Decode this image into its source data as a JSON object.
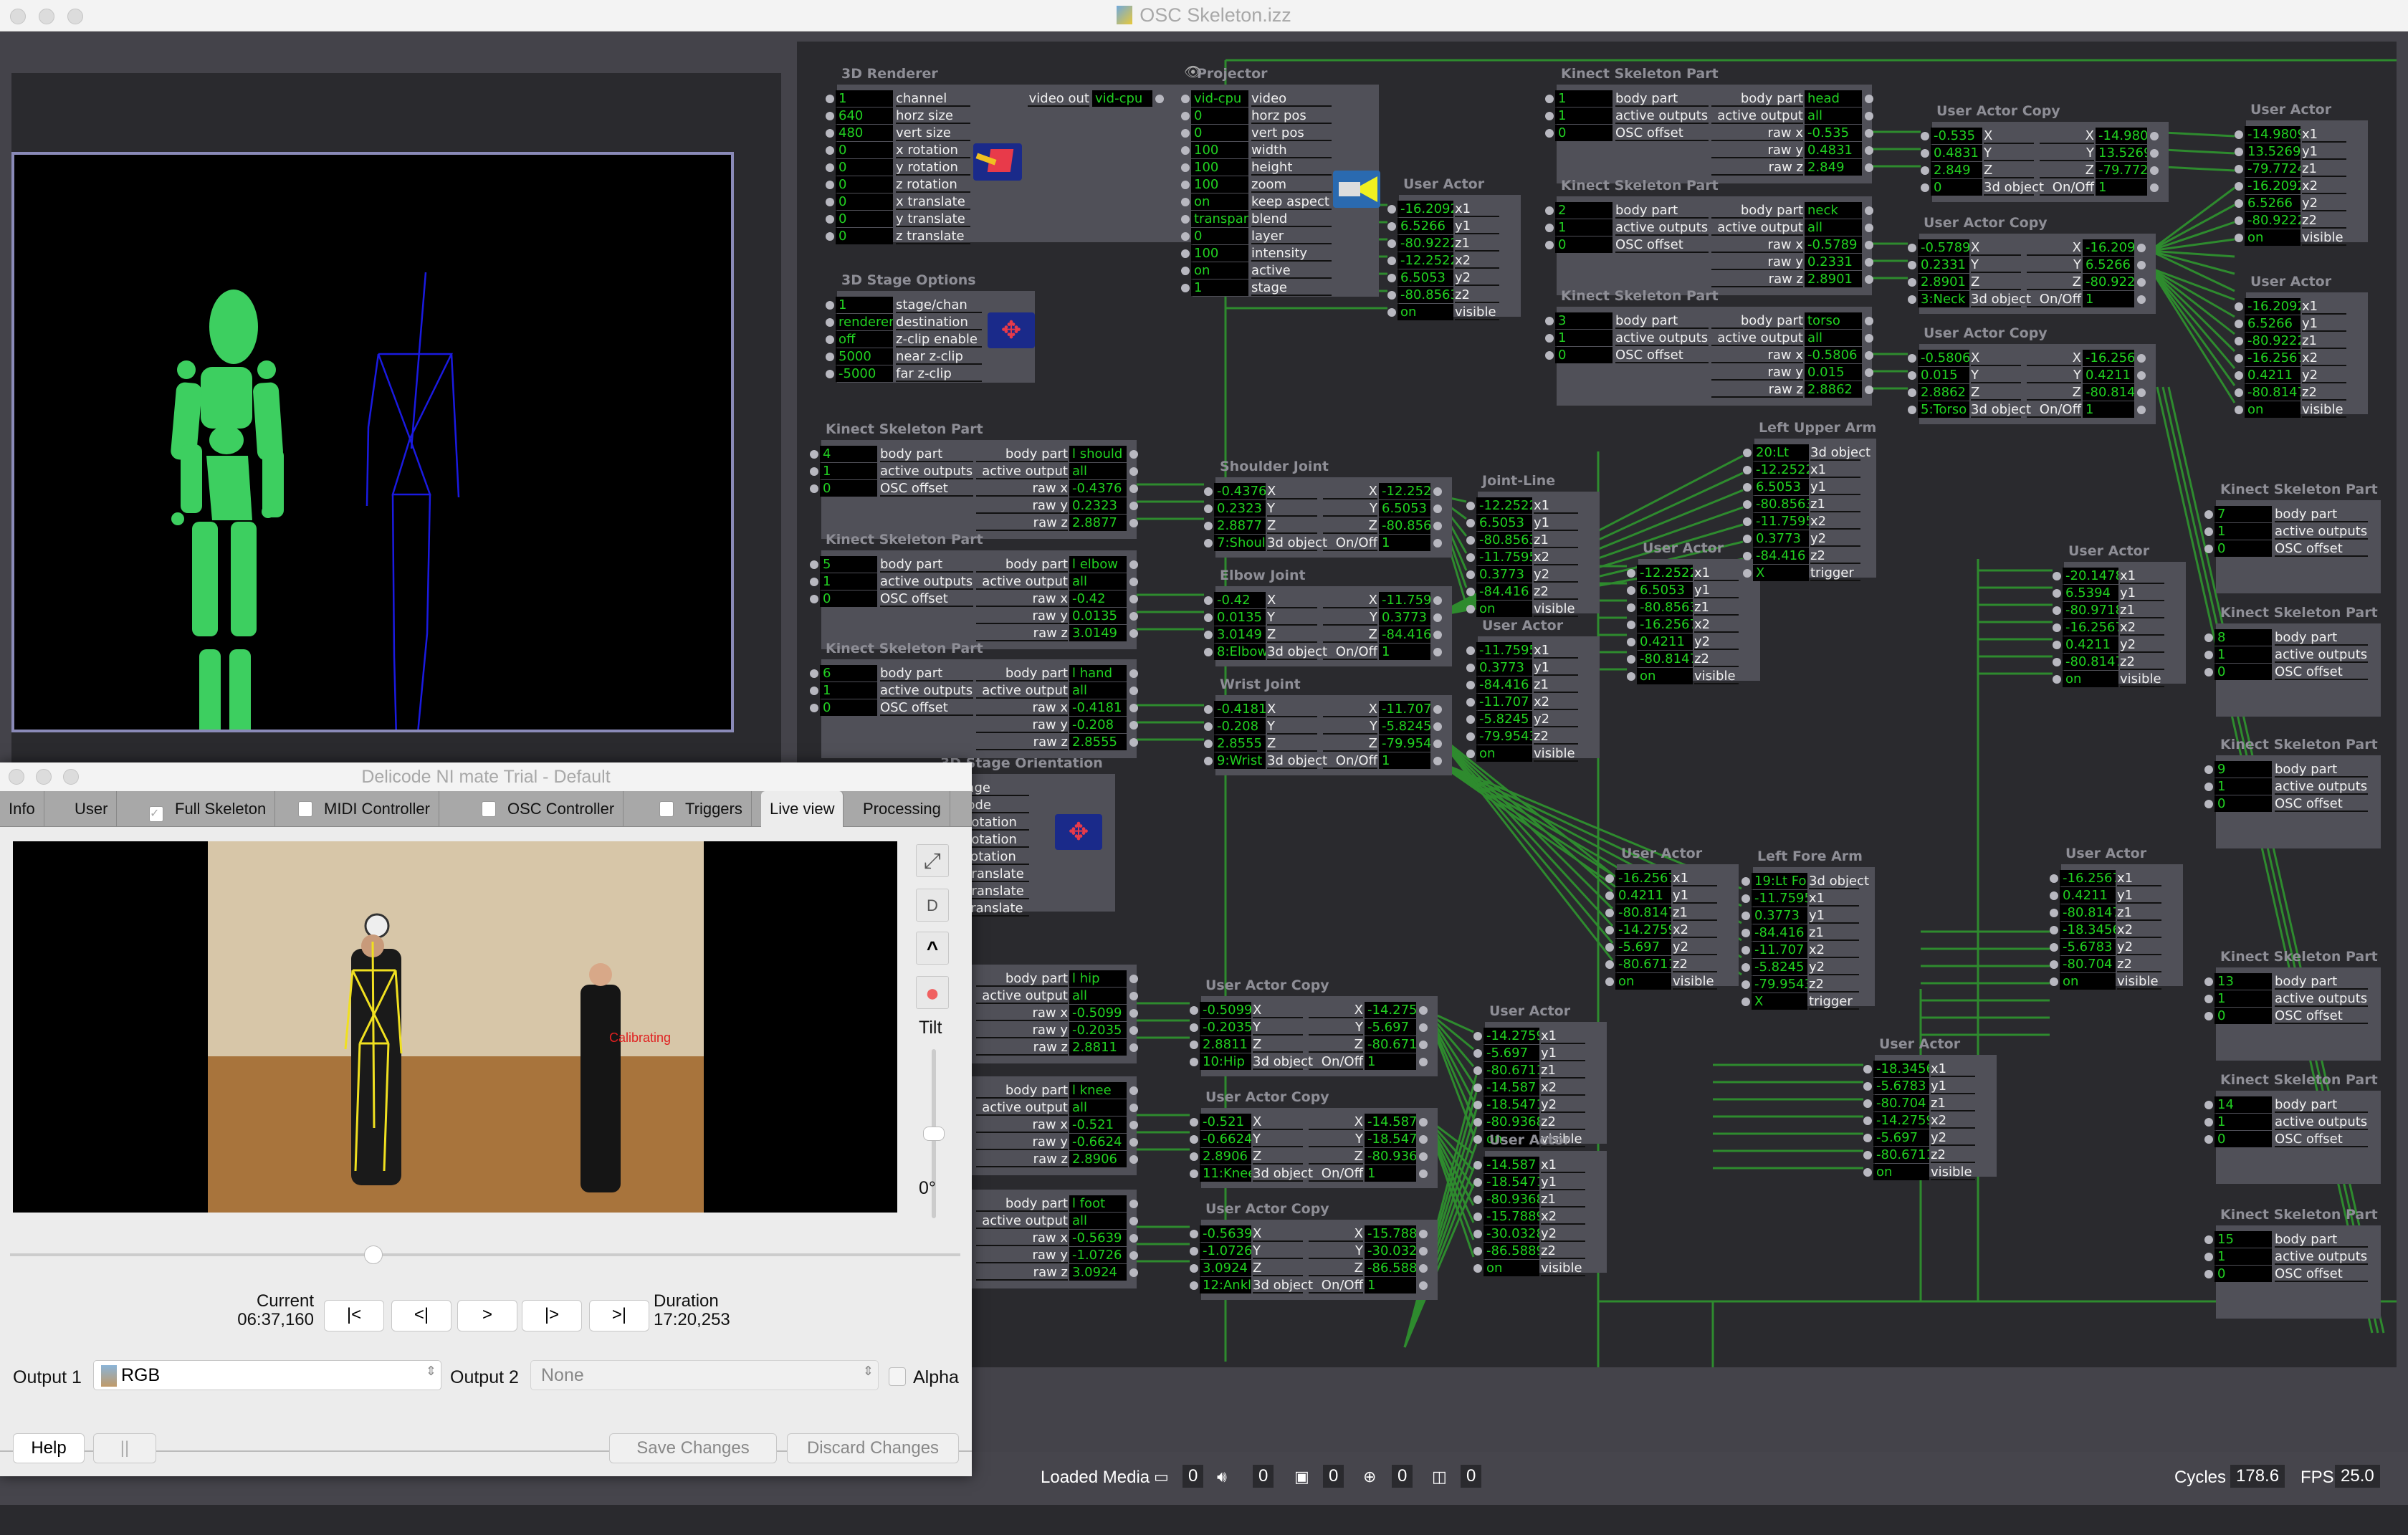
{
  "window": {
    "title": "OSC Skeleton.izz"
  },
  "editor": {
    "renderer": {
      "title": "3D Renderer",
      "inputs": [
        [
          "1",
          "channel"
        ],
        [
          "640",
          "horz size"
        ],
        [
          "480",
          "vert size"
        ],
        [
          "0",
          "x rotation"
        ],
        [
          "0",
          "y rotation"
        ],
        [
          "0",
          "z rotation"
        ],
        [
          "0",
          "x translate"
        ],
        [
          "0",
          "y translate"
        ],
        [
          "0",
          "z translate"
        ]
      ],
      "output_label": "video out",
      "output_value": "vid-cpu"
    },
    "stage_options": {
      "title": "3D Stage Options",
      "inputs": [
        [
          "1",
          "stage/chan"
        ],
        [
          "renderer",
          "destination"
        ],
        [
          "off",
          "z-clip enable"
        ],
        [
          "5000",
          "near z-clip"
        ],
        [
          "-5000",
          "far z-clip"
        ]
      ]
    },
    "projector": {
      "title": "Projector",
      "inputs": [
        [
          "vid-cpu",
          "video"
        ],
        [
          "0",
          "horz pos"
        ],
        [
          "0",
          "vert pos"
        ],
        [
          "100",
          "width"
        ],
        [
          "100",
          "height"
        ],
        [
          "100",
          "zoom"
        ],
        [
          "on",
          "keep aspect"
        ],
        [
          "transpar",
          "blend"
        ],
        [
          "0",
          "layer"
        ],
        [
          "100",
          "intensity"
        ],
        [
          "on",
          "active"
        ],
        [
          "1",
          "stage"
        ]
      ]
    },
    "stage_orientation": {
      "title": "3D Stage Orientation",
      "inputs": [
        [
          "",
          "stage"
        ],
        [
          "",
          "mode"
        ],
        [
          "",
          "x rotation"
        ],
        [
          "",
          "y rotation"
        ],
        [
          "",
          "z rotation"
        ],
        [
          "",
          "x translate"
        ],
        [
          "",
          "y translate"
        ],
        [
          "",
          "z translate"
        ]
      ]
    },
    "kinect_parts": [
      {
        "title": "Kinect Skeleton Part",
        "in": [
          "1",
          "1",
          "0"
        ],
        "body_part": "head",
        "active_output": "all",
        "raw": [
          "-0.535",
          "0.4831",
          "2.849"
        ]
      },
      {
        "title": "Kinect Skeleton Part",
        "in": [
          "2",
          "1",
          "0"
        ],
        "body_part": "neck",
        "active_output": "all",
        "raw": [
          "-0.5789",
          "0.2331",
          "2.8901"
        ]
      },
      {
        "title": "Kinect Skeleton Part",
        "in": [
          "3",
          "1",
          "0"
        ],
        "body_part": "torso",
        "active_output": "all",
        "raw": [
          "-0.5806",
          "0.015",
          "2.8862"
        ]
      },
      {
        "title": "Kinect Skeleton Part",
        "in": [
          "4",
          "1",
          "0"
        ],
        "body_part": "l should",
        "active_output": "all",
        "raw": [
          "-0.4376",
          "0.2323",
          "2.8877"
        ]
      },
      {
        "title": "Kinect Skeleton Part",
        "in": [
          "5",
          "1",
          "0"
        ],
        "body_part": "l elbow",
        "active_output": "all",
        "raw": [
          "-0.42",
          "0.0135",
          "3.0149"
        ]
      },
      {
        "title": "Kinect Skeleton Part",
        "in": [
          "6",
          "1",
          "0"
        ],
        "body_part": "l hand",
        "active_output": "all",
        "raw": [
          "-0.4181",
          "-0.208",
          "2.8555"
        ]
      },
      {
        "title": "",
        "in": [
          "",
          "",
          ""
        ],
        "body_part": "l hip",
        "active_output": "all",
        "raw": [
          "-0.5099",
          "-0.2035",
          "2.8811"
        ]
      },
      {
        "title": "",
        "in": [
          "",
          "",
          ""
        ],
        "body_part": "l knee",
        "active_output": "all",
        "raw": [
          "-0.521",
          "-0.6624",
          "2.8906"
        ]
      },
      {
        "title": "",
        "in": [
          "",
          "",
          ""
        ],
        "body_part": "l foot",
        "active_output": "all",
        "raw": [
          "-0.5639",
          "-1.0726",
          "3.0924"
        ]
      }
    ],
    "kinect_parts_right": [
      {
        "title": "Kinect Skeleton Part",
        "in": [
          "7",
          "1",
          "0"
        ]
      },
      {
        "title": "Kinect Skeleton Part",
        "in": [
          "8",
          "1",
          "0"
        ]
      },
      {
        "title": "Kinect Skeleton Part",
        "in": [
          "9",
          "1",
          "0"
        ]
      },
      {
        "title": "Kinect Skeleton Part",
        "in": [
          "13",
          "1",
          "0"
        ]
      },
      {
        "title": "Kinect Skeleton Part",
        "in": [
          "14",
          "1",
          "0"
        ]
      },
      {
        "title": "Kinect Skeleton Part",
        "in": [
          "15",
          "1",
          "0"
        ]
      }
    ],
    "kinect_labels": {
      "body_part": "body part",
      "active_outputs": "active outputs",
      "osc_offset": "OSC offset",
      "active_output": "active output",
      "raw_x": "raw x",
      "raw_y": "raw y",
      "raw_z": "raw z"
    },
    "copies": [
      {
        "title": "User Actor Copy",
        "in": [
          "-0.535",
          "0.4831",
          "2.849",
          "0"
        ],
        "out": [
          "-14.9809",
          "13.5269",
          "-79.7724",
          "1"
        ]
      },
      {
        "title": "User Actor Copy",
        "in": [
          "-0.5789",
          "0.2331",
          "2.8901",
          "3:Neck J"
        ],
        "out": [
          "-16.2092",
          "6.5266",
          "-80.9222",
          "1"
        ]
      },
      {
        "title": "User Actor Copy",
        "in": [
          "-0.5806",
          "0.015",
          "2.8862",
          "5:Torso J"
        ],
        "out": [
          "-16.2567",
          "0.4211",
          "-80.8147",
          "1"
        ]
      },
      {
        "title": "Shoulder Joint",
        "in": [
          "-0.4376",
          "0.2323",
          "2.8877",
          "7:Should"
        ],
        "out": [
          "-12.2522",
          "6.5053",
          "-80.8563",
          "1"
        ]
      },
      {
        "title": "Elbow Joint",
        "in": [
          "-0.42",
          "0.0135",
          "3.0149",
          "8:Elbow"
        ],
        "out": [
          "-11.7595",
          "0.3773",
          "-84.416",
          "1"
        ]
      },
      {
        "title": "Wrist Joint",
        "in": [
          "-0.4181",
          "-0.208",
          "2.8555",
          "9:Wrist J"
        ],
        "out": [
          "-11.707",
          "-5.8245",
          "-79.9543",
          "1"
        ]
      },
      {
        "title": "User Actor Copy",
        "in": [
          "-0.5099",
          "-0.2035",
          "2.8811",
          "10:Hip J"
        ],
        "out": [
          "-14.2759",
          "-5.697",
          "-80.6711",
          "1"
        ]
      },
      {
        "title": "User Actor Copy",
        "in": [
          "-0.521",
          "-0.6624",
          "2.8906",
          "11:Knee"
        ],
        "out": [
          "-14.587",
          "-18.5471",
          "-80.9368",
          "1"
        ]
      },
      {
        "title": "User Actor Copy",
        "in": [
          "-0.5639",
          "-1.0726",
          "3.0924",
          "12:Ankle"
        ],
        "out": [
          "-15.7889",
          "-30.0328",
          "-86.5889",
          "1"
        ]
      }
    ],
    "copy_labels": {
      "x": "X",
      "y": "Y",
      "z": "Z",
      "obj": "3d object",
      "onoff": "On/Off"
    },
    "user_actors": [
      {
        "title": "User Actor",
        "v": [
          "-16.2092",
          "6.5266",
          "-80.9222",
          "-12.2522",
          "6.5053",
          "-80.8563",
          "on"
        ]
      },
      {
        "title": "User Actor",
        "v": [
          "-14.9809",
          "13.5269",
          "-79.7724",
          "-16.2092",
          "6.5266",
          "-80.9222",
          "on"
        ]
      },
      {
        "title": "User Actor",
        "v": [
          "-16.2092",
          "6.5266",
          "-80.9222",
          "-16.2567",
          "0.4211",
          "-80.8147",
          "on"
        ]
      },
      {
        "title": "Joint-Line",
        "v": [
          "-12.2522",
          "6.5053",
          "-80.8563",
          "-11.7595",
          "0.3773",
          "-84.416",
          "on"
        ]
      },
      {
        "title": "User Actor",
        "v": [
          "-12.2522",
          "6.5053",
          "-80.8563",
          "-16.2567",
          "0.4211",
          "-80.8147",
          "on"
        ]
      },
      {
        "title": "User Actor",
        "v": [
          "-11.7595",
          "0.3773",
          "-84.416",
          "-11.707",
          "-5.8245",
          "-79.9543",
          "on"
        ]
      },
      {
        "title": "User Actor",
        "v": [
          "-20.1478",
          "6.5394",
          "-80.9718",
          "-16.2567",
          "0.4211",
          "-80.8147",
          "on"
        ]
      },
      {
        "title": "User Actor",
        "v": [
          "-16.2567",
          "0.4211",
          "-80.8147",
          "-14.2759",
          "-5.697",
          "-80.6711",
          "on"
        ]
      },
      {
        "title": "User Actor",
        "v": [
          "-16.2567",
          "0.4211",
          "-80.8147",
          "-18.3456",
          "-5.6783",
          "-80.704",
          "on"
        ]
      },
      {
        "title": "User Actor",
        "v": [
          "-14.2759",
          "-5.697",
          "-80.6711",
          "-14.587",
          "-18.5471",
          "-80.9368",
          "on"
        ]
      },
      {
        "title": "User Actor",
        "v": [
          "-18.3456",
          "-5.6783",
          "-80.704",
          "-14.2759",
          "-5.697",
          "-80.6711",
          "on"
        ]
      },
      {
        "title": "User Actor",
        "v": [
          "-14.587",
          "-18.5471",
          "-80.9368",
          "-15.7889",
          "-30.0328",
          "-86.5889",
          "on"
        ]
      }
    ],
    "actor_labels": [
      "x1",
      "y1",
      "z1",
      "x2",
      "y2",
      "z2",
      "visible"
    ],
    "arms": [
      {
        "title": "Left Upper Arm",
        "obj": "20:Lt Up",
        "v": [
          "-12.2522",
          "6.5053",
          "-80.8563",
          "-11.7595",
          "0.3773",
          "-84.416",
          "X"
        ]
      },
      {
        "title": "Left Fore Arm",
        "obj": "19:Lt Fo",
        "v": [
          "-11.7595",
          "0.3773",
          "-84.416",
          "-11.707",
          "-5.8245",
          "-79.9543",
          "X"
        ]
      }
    ],
    "arm_labels": [
      "3d object",
      "x1",
      "y1",
      "z1",
      "x2",
      "y2",
      "z2",
      "trigger"
    ]
  },
  "status": {
    "loaded_media": "Loaded Media",
    "counts": [
      "0",
      "0",
      "0",
      "0",
      "0"
    ],
    "cycles_label": "Cycles",
    "cycles": "178.6",
    "fps_label": "FPS",
    "fps": "25.0"
  },
  "nimate": {
    "title": "Delicode NI mate  Trial  - Default",
    "tabs": [
      {
        "label": "Info",
        "checkbox": false
      },
      {
        "label": "User",
        "checkbox": false
      },
      {
        "label": "Full Skeleton",
        "checkbox": true,
        "checked": true
      },
      {
        "label": "MIDI Controller",
        "checkbox": true,
        "checked": false
      },
      {
        "label": "OSC Controller",
        "checkbox": true,
        "checked": false
      },
      {
        "label": "Triggers",
        "checkbox": true,
        "checked": false
      },
      {
        "label": "Live view",
        "checkbox": false,
        "active": true
      },
      {
        "label": "Processing",
        "checkbox": false
      }
    ],
    "overlay_text": "Calibrating",
    "side_buttons": {
      "fullscreen": "⤢",
      "d": "D",
      "up": "^",
      "record": "●"
    },
    "tilt_label": "Tilt",
    "tilt_value": "0°",
    "tilt_fraction": 0.5,
    "playback_progress": 0.382,
    "current_label": "Current",
    "current_value": "06:37,160",
    "duration_label": "Duration",
    "duration_value": "17:20,253",
    "transport": [
      "|<",
      "<|",
      ">",
      "|>",
      ">|"
    ],
    "output1_label": "Output 1",
    "output1_value": "RGB",
    "output2_label": "Output 2",
    "output2_value": "None",
    "alpha_label": "Alpha",
    "help_label": "Help",
    "pause_label": "||",
    "save_label": "Save Changes",
    "discard_label": "Discard Changes"
  },
  "colors": {
    "wire": "#2e8b2e",
    "value": "#21d021",
    "panel": "#505058"
  }
}
